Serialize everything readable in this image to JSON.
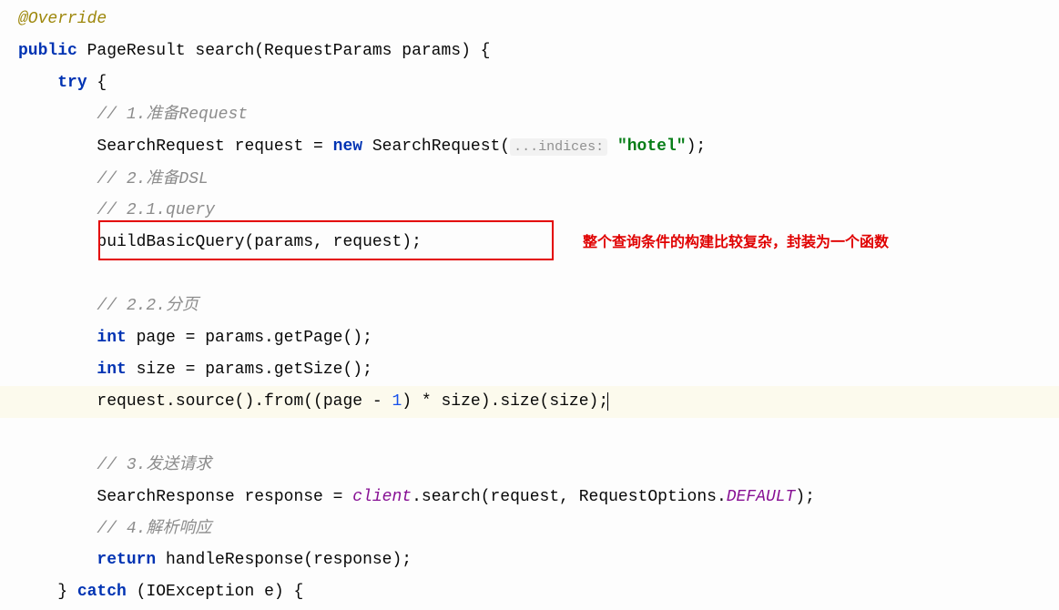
{
  "code": {
    "annotation": "@Override",
    "l1_public": "public",
    "l1_rest": " PageResult search(RequestParams params) {",
    "l2_try": "try",
    "l2_brace": " {",
    "c1": "// 1.准备Request",
    "l3a": "SearchRequest request = ",
    "l3_new": "new",
    "l3b": " SearchRequest(",
    "l3_hint": "...indices:",
    "l3_space": " ",
    "l3_str": "\"hotel\"",
    "l3c": ");",
    "c2": "// 2.准备DSL",
    "c3": "// 2.1.query",
    "l4": "buildBasicQuery(params, request);",
    "c4": "// 2.2.分页",
    "l5_int": "int",
    "l5a": " page = params.getPage();",
    "l6_int": "int",
    "l6a": " size = params.getSize();",
    "l7a": "request.source().from((page - ",
    "l7_num": "1",
    "l7b": ") * size).size(size);",
    "c5": "// 3.发送请求",
    "l8a": "SearchResponse response = ",
    "l8_field": "client",
    "l8b": ".search(request, RequestOptions.",
    "l8_const": "DEFAULT",
    "l8c": ");",
    "c6": "// 4.解析响应",
    "l9_ret": "return",
    "l9a": " handleResponse(response);",
    "l10a": "} ",
    "l10_catch": "catch",
    "l10b": " (IOException e) {"
  },
  "annotation_note": "整个查询条件的构建比较复杂，封装为一个函数"
}
